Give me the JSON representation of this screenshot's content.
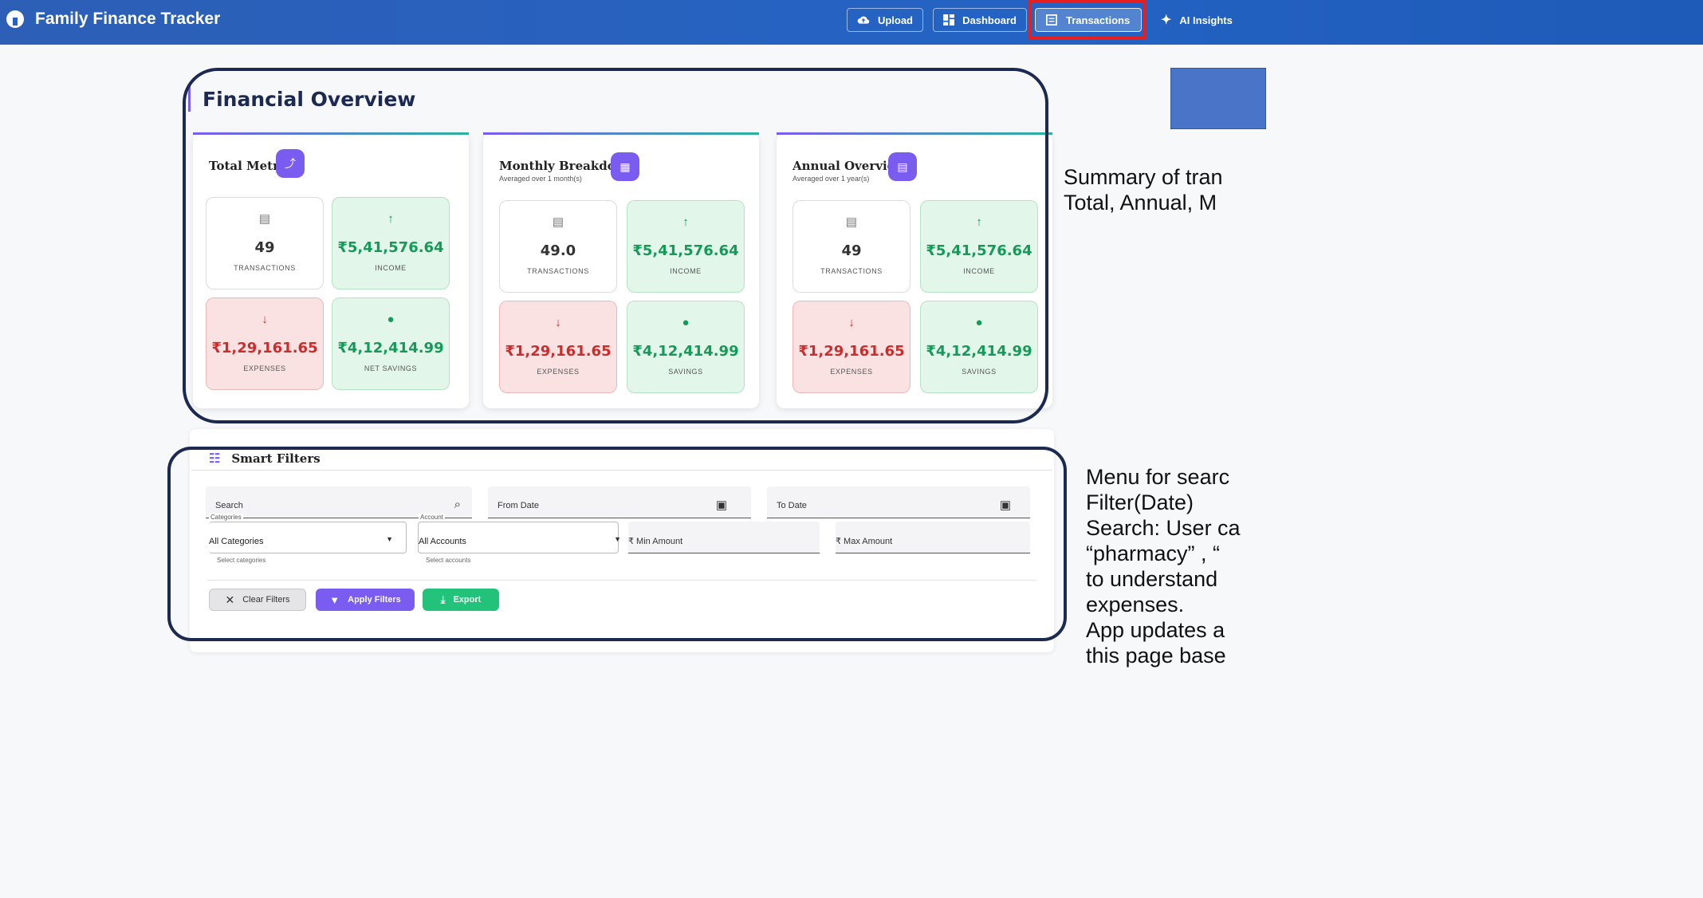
{
  "app": {
    "title": "Family Finance Tracker"
  },
  "nav": {
    "upload": "Upload",
    "dashboard": "Dashboard",
    "transactions": "Transactions",
    "ai_insights": "AI Insights"
  },
  "overview": {
    "title": "Financial Overview",
    "cards": [
      {
        "title": "Total Metrics",
        "subtitle": "",
        "icon": "trending-up-icon",
        "transactions": {
          "value": "49",
          "label": "TRANSACTIONS"
        },
        "income": {
          "value": "₹5,41,576.64",
          "label": "INCOME"
        },
        "expenses": {
          "value": "₹1,29,161.65",
          "label": "EXPENSES"
        },
        "savings": {
          "value": "₹4,12,414.99",
          "label": "NET SAVINGS"
        }
      },
      {
        "title": "Monthly Breakdown",
        "subtitle": "Averaged over 1 month(s)",
        "icon": "calendar-icon",
        "transactions": {
          "value": "49.0",
          "label": "TRANSACTIONS"
        },
        "income": {
          "value": "₹5,41,576.64",
          "label": "INCOME"
        },
        "expenses": {
          "value": "₹1,29,161.65",
          "label": "EXPENSES"
        },
        "savings": {
          "value": "₹4,12,414.99",
          "label": "SAVINGS"
        }
      },
      {
        "title": "Annual Overview",
        "subtitle": "Averaged over 1 year(s)",
        "icon": "event-note-icon",
        "transactions": {
          "value": "49",
          "label": "TRANSACTIONS"
        },
        "income": {
          "value": "₹5,41,576.64",
          "label": "INCOME"
        },
        "expenses": {
          "value": "₹1,29,161.65",
          "label": "EXPENSES"
        },
        "savings": {
          "value": "₹4,12,414.99",
          "label": "SAVINGS"
        }
      }
    ]
  },
  "filters": {
    "title": "Smart Filters",
    "search_placeholder": "Search",
    "from_date_placeholder": "From Date",
    "to_date_placeholder": "To Date",
    "categories": {
      "label": "Categories",
      "value": "All Categories",
      "helper": "Select categories"
    },
    "account": {
      "label": "Account",
      "value": "All Accounts",
      "helper": "Select accounts"
    },
    "min_amount_placeholder": "₹ Min Amount",
    "max_amount_placeholder": "₹ Max Amount",
    "clear_label": "Clear Filters",
    "apply_label": "Apply Filters",
    "export_label": "Export"
  },
  "annotations": {
    "summary_note": "Summary of tran\nTotal, Annual, M",
    "filters_note": "Menu for searc\nFilter(Date)\nSearch: User ca\n“pharmacy” , “\nto understand\nexpenses.\nApp updates a\nthis page base"
  },
  "colors": {
    "topbar": "#2463c4",
    "accent": "#7b5cf0",
    "income_green": "#159a5a",
    "expense_red": "#c92d2d",
    "highlight_red": "#e51f1f",
    "outline_navy": "#1c2a52"
  }
}
